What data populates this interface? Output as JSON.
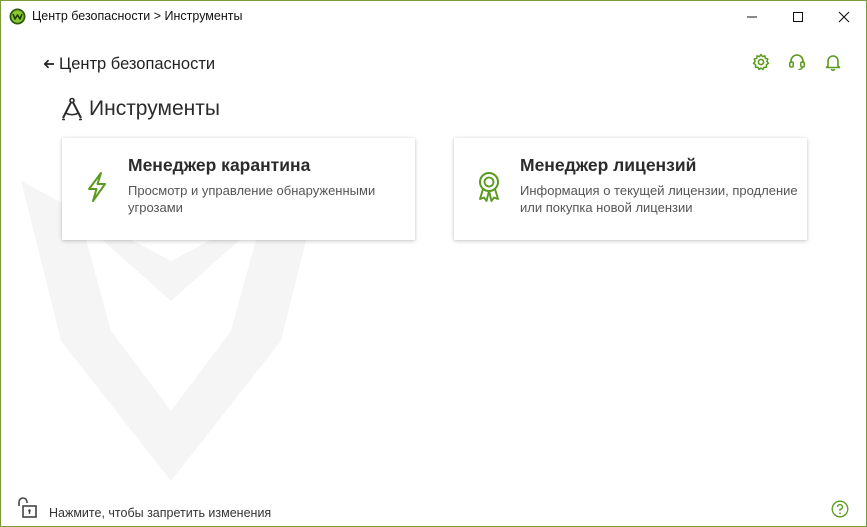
{
  "window": {
    "title": "Центр безопасности > Инструменты",
    "controls": [
      "minimize",
      "maximize",
      "close"
    ]
  },
  "nav": {
    "back_label": "Центр безопасности"
  },
  "header_icons": [
    "gear-icon",
    "headset-icon",
    "bell-icon"
  ],
  "page": {
    "title": "Инструменты",
    "title_icon": "compass-tools-icon"
  },
  "cards": [
    {
      "title": "Менеджер карантина",
      "description": "Просмотр и управление обнаруженными угрозами",
      "icon": "lightning-icon"
    },
    {
      "title": "Менеджер лицензий",
      "description": "Информация о текущей лицензии, продление или покупка новой лицензии",
      "icon": "award-ribbon-icon"
    }
  ],
  "status_bar": {
    "text": "Нажмите, чтобы запретить изменения",
    "lock_icon": "unlocked-padlock-icon",
    "help_icon": "help-icon"
  },
  "colors": {
    "accent_green": "#5a9a1e",
    "window_border": "#7a9a3c",
    "text_dark": "#2b2b2b",
    "text_muted": "#555555"
  }
}
